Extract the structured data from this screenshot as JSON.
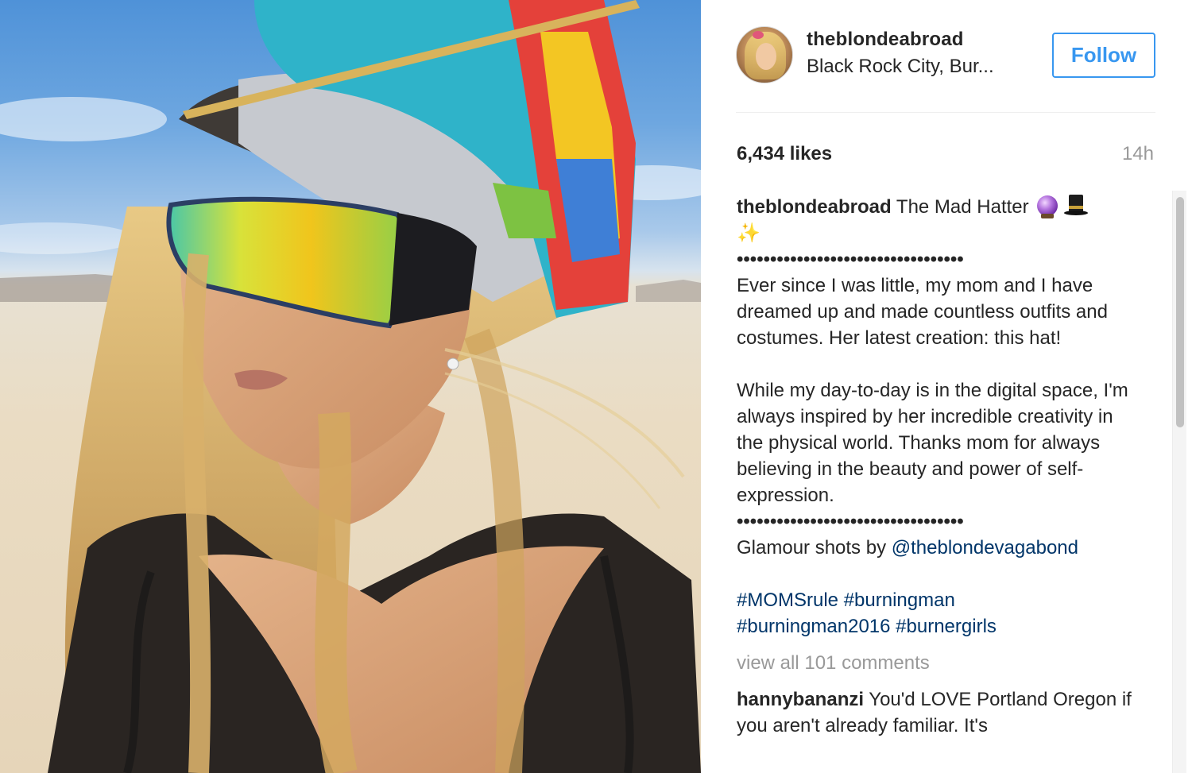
{
  "post": {
    "username": "theblondeabroad",
    "location": "Black Rock City, Bur...",
    "follow_label": "Follow",
    "likes": "6,434 likes",
    "timestamp": "14h"
  },
  "caption": {
    "author": "theblondeabroad",
    "title": " The Mad Hatter",
    "emoji_icons": [
      "crystal-ball-icon",
      "top-hat-icon",
      "sparkles-icon"
    ],
    "sparkles": "✨",
    "dots": "••••••••••••••••••••••••••••••••••",
    "paragraph1": "Ever since I was little, my mom and I have dreamed up and made countless outfits and costumes. Her latest creation: this hat!",
    "paragraph2": "While my day-to-day is in the digital space, I'm always inspired by her incredible creativity in the physical world. Thanks mom for always believing in the beauty and power of self-expression.",
    "credit_prefix": "Glamour shots by ",
    "credit_handle": "@theblondevagabond",
    "hashtags": [
      "#MOMSrule",
      "#burningman",
      "#burningman2016",
      "#burnergirls"
    ]
  },
  "view_all_comments": "view all 101 comments",
  "comments": [
    {
      "user": "hannybananzi",
      "text": " You'd LOVE Portland Oregon if you aren't already familiar. It's"
    }
  ],
  "colors": {
    "link": "#003569",
    "follow": "#3897f0",
    "muted": "#999999",
    "text": "#262626"
  }
}
